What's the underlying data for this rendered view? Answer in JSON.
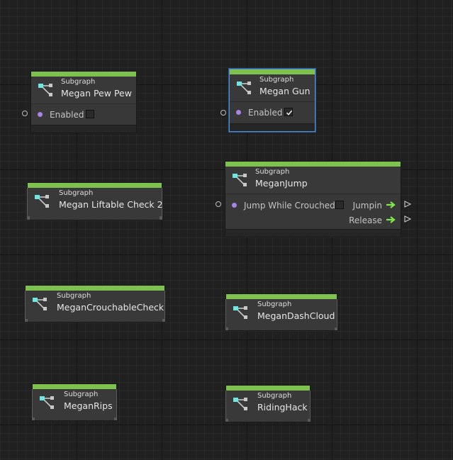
{
  "colors": {
    "header_bar": "#7ec14e",
    "node_bg": "#393939",
    "footer_bg": "#262626",
    "selection": "#4d8ccd",
    "bool_port": "#a883e8",
    "flow_arrow": "#7ee84a",
    "icon_accent": "#6ee7e0"
  },
  "nodes": {
    "pew_pew": {
      "subtitle": "Subgraph",
      "title": "Megan Pew Pew",
      "port_label": "Enabled",
      "enabled": false
    },
    "gun": {
      "subtitle": "Subgraph",
      "title": "Megan Gun",
      "port_label": "Enabled",
      "enabled": true,
      "selected": true
    },
    "liftable": {
      "subtitle": "Subgraph",
      "title": "Megan Liftable Check 2"
    },
    "jump": {
      "subtitle": "Subgraph",
      "title": "MeganJump",
      "port_label": "Jump While Crouched",
      "jump_while_crouched": false,
      "out1": "Jumpin",
      "out2": "Release"
    },
    "crouchable": {
      "subtitle": "Subgraph",
      "title": "MeganCrouchableCheck"
    },
    "dash_cloud": {
      "subtitle": "Subgraph",
      "title": "MeganDashCloud"
    },
    "rips": {
      "subtitle": "Subgraph",
      "title": "MeganRips"
    },
    "riding": {
      "subtitle": "Subgraph",
      "title": "RidingHack"
    }
  }
}
